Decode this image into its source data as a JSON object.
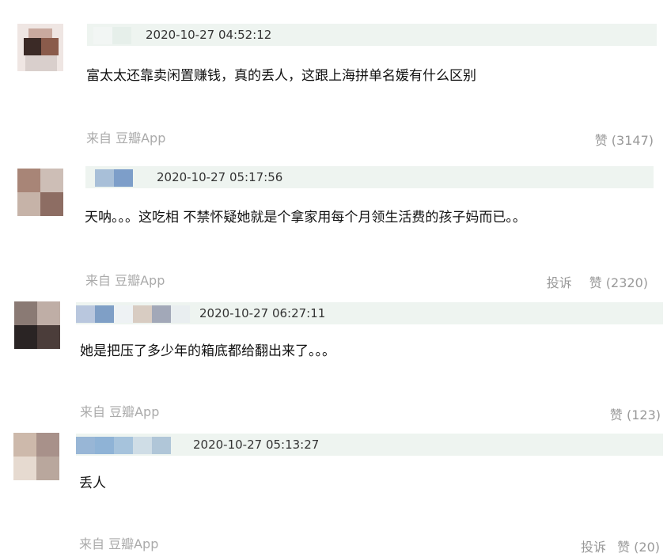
{
  "comments": [
    {
      "timestamp": "2020-10-27 04:52:12",
      "text": "富太太还靠卖闲置赚钱，真的丢人，这跟上海拼单名媛有什么区别",
      "source": "来自 豆瓣App",
      "report": "",
      "like": "赞 (3147)"
    },
    {
      "timestamp": "2020-10-27 05:17:56",
      "text": "天呐。。。这吃相 不禁怀疑她就是个拿家用每个月领生活费的孩子妈而已。。",
      "source": "来自 豆瓣App",
      "report": "投诉",
      "like": "赞 (2320)"
    },
    {
      "timestamp": "2020-10-27 06:27:11",
      "text": "她是把压了多少年的箱底都给翻出来了。。。",
      "source": "来自 豆瓣App",
      "report": "",
      "like": "赞 (123)"
    },
    {
      "timestamp": "2020-10-27 05:13:27",
      "text": "丢人",
      "source": "来自 豆瓣App",
      "report": "投诉",
      "like": "赞 (20)"
    }
  ],
  "colors": {
    "meta_bar": "#eef4f0",
    "muted_text": "#aaaaaa"
  }
}
